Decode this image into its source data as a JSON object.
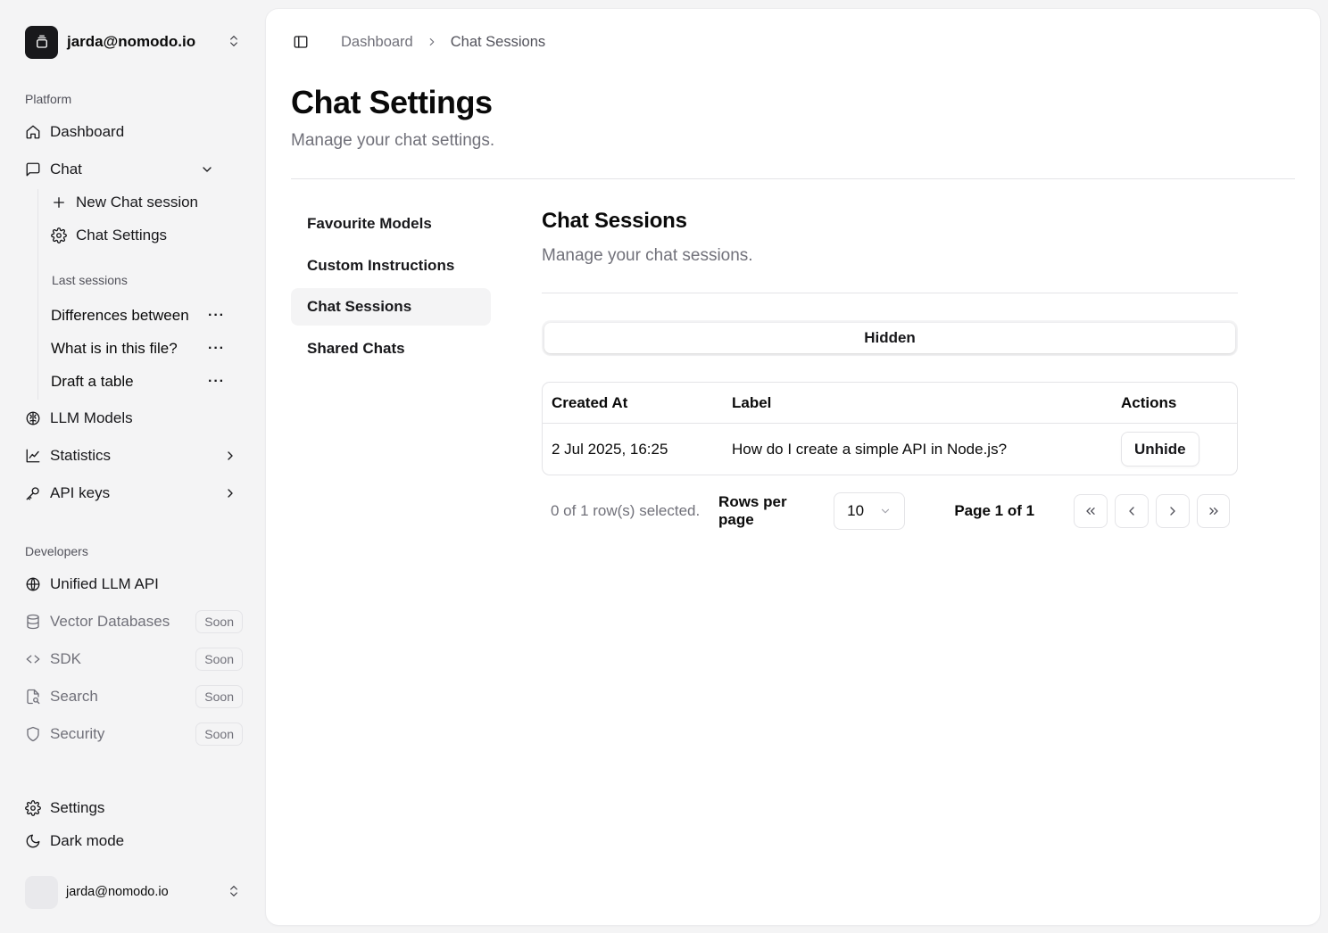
{
  "team": {
    "name": "jarda@nomodo.io"
  },
  "sidebar": {
    "platform_label": "Platform",
    "dashboard": "Dashboard",
    "chat": "Chat",
    "chat_sub": {
      "new_session": "New Chat session",
      "settings": "Chat Settings"
    },
    "last_sessions_label": "Last sessions",
    "sessions": [
      {
        "label": "Differences between"
      },
      {
        "label": "What is in this file?"
      },
      {
        "label": "Draft a table"
      }
    ],
    "llm_models": "LLM Models",
    "statistics": "Statistics",
    "api_keys": "API keys",
    "developers_label": "Developers",
    "unified_api": "Unified LLM API",
    "vector_db": "Vector Databases",
    "sdk": "SDK",
    "search": "Search",
    "security": "Security",
    "soon_badge": "Soon",
    "settings": "Settings",
    "dark_mode": "Dark mode",
    "user": "jarda@nomodo.io"
  },
  "breadcrumb": {
    "root": "Dashboard",
    "current": "Chat Sessions"
  },
  "page": {
    "title": "Chat Settings",
    "subtitle": "Manage your chat settings."
  },
  "settings_nav": {
    "favourite_models": "Favourite Models",
    "custom_instructions": "Custom Instructions",
    "chat_sessions": "Chat Sessions",
    "shared_chats": "Shared Chats"
  },
  "section": {
    "title": "Chat Sessions",
    "subtitle": "Manage your chat sessions.",
    "tab": "Hidden",
    "table": {
      "headers": {
        "created": "Created At",
        "label": "Label",
        "actions": "Actions"
      },
      "rows": [
        {
          "created": "2 Jul 2025, 16:25",
          "label": "How do I create a simple API in Node.js?",
          "action": "Unhide"
        }
      ]
    },
    "pagination": {
      "selected": "0 of 1 row(s) selected.",
      "rows_per_page_label": "Rows per page",
      "rows_per_page_value": "10",
      "page_of": "Page 1 of 1"
    }
  }
}
